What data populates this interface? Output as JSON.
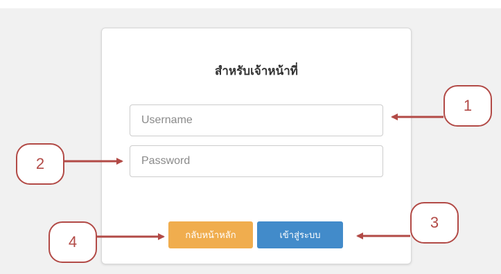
{
  "login_form": {
    "title": "สำหรับเจ้าหน้าที่",
    "username_placeholder": "Username",
    "password_placeholder": "Password",
    "back_button_label": "กลับหน้าหลัก",
    "login_button_label": "เข้าสู่ระบบ"
  },
  "callouts": {
    "c1": "1",
    "c2": "2",
    "c3": "3",
    "c4": "4"
  },
  "colors": {
    "back_button": "#f0ad4e",
    "login_button": "#428bca",
    "annotation": "#b24a46"
  }
}
